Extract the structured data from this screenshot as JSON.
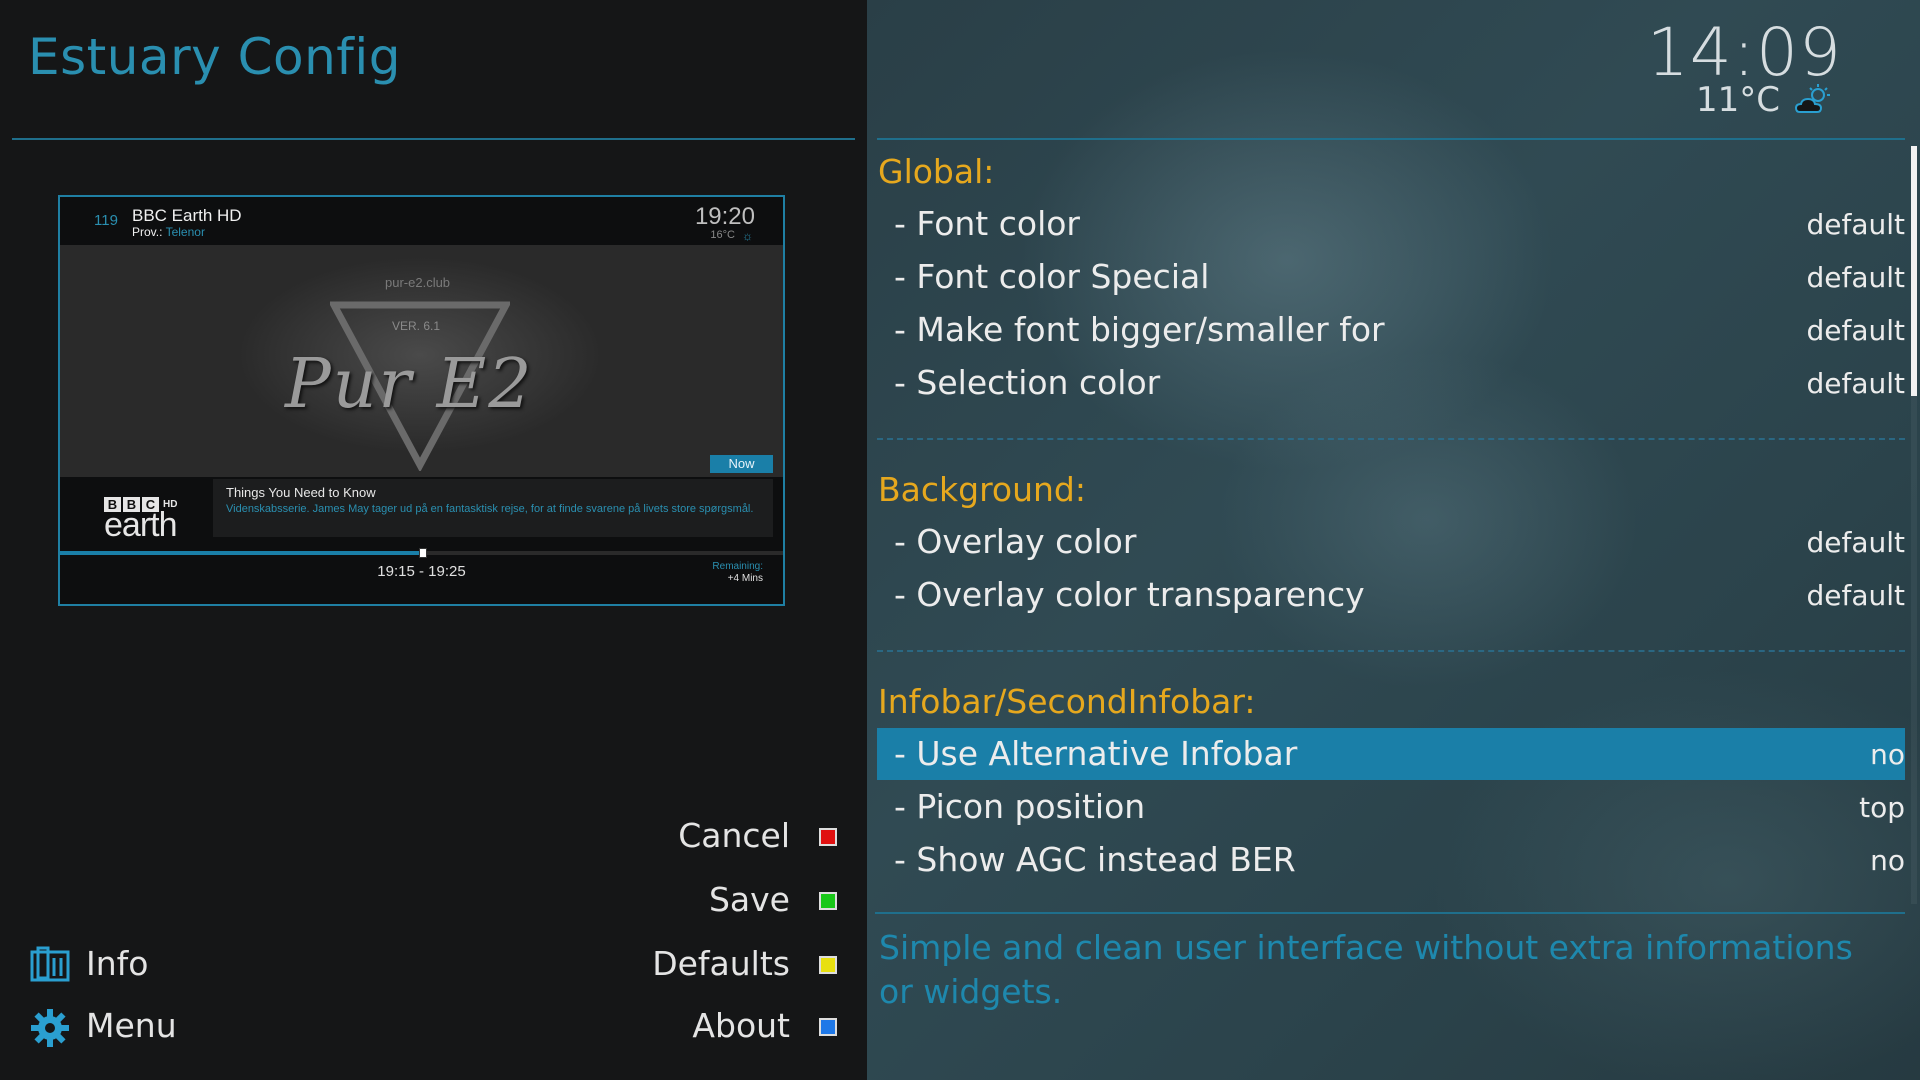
{
  "app": {
    "title": "Estuary Config"
  },
  "clock": {
    "time": "14:09",
    "temperature": "11°C",
    "weather_icon": "partly-cloudy-icon"
  },
  "preview": {
    "channel_number": "119",
    "channel_name": "BBC Earth HD",
    "provider_label": "Prov.:",
    "provider": "Telenor",
    "time": "19:20",
    "temperature": "16°C",
    "site": "pur-e2.club",
    "version": "VER. 6.1",
    "logo_text": "Pur E2",
    "now_badge": "Now",
    "bbc_letters": [
      "B",
      "B",
      "C"
    ],
    "bbc_hd": "HD",
    "bbc_earth": "earth",
    "program_title": "Things You Need to Know",
    "program_desc": "Videnskabsserie. James May tager ud på en fantasktisk rejse, for at finde svarene på livets store spørgsmål.",
    "progress": 0.5,
    "time_range": "19:15 - 19:25",
    "remaining_label": "Remaining:",
    "remaining_value": "+4 Mins"
  },
  "buttons": {
    "cancel": {
      "label": "Cancel",
      "color": "#e01010"
    },
    "save": {
      "label": "Save",
      "color": "#18c818"
    },
    "defaults": {
      "label": "Defaults",
      "color": "#e8e010"
    },
    "about": {
      "label": "About",
      "color": "#1e78e8"
    }
  },
  "nav": {
    "info": {
      "label": "Info",
      "icon": "info-icon"
    },
    "menu": {
      "label": "Menu",
      "icon": "gear-icon"
    }
  },
  "settings": {
    "global": {
      "header": "Global:",
      "items": [
        {
          "label": "- Font color",
          "value": "default"
        },
        {
          "label": "- Font color Special",
          "value": "default"
        },
        {
          "label": "- Make font bigger/smaller for",
          "value": "default"
        },
        {
          "label": "- Selection color",
          "value": "default"
        }
      ]
    },
    "background": {
      "header": "Background:",
      "items": [
        {
          "label": "- Overlay color",
          "value": "default"
        },
        {
          "label": "- Overlay color transparency",
          "value": "default"
        }
      ]
    },
    "infobar": {
      "header": "Infobar/SecondInfobar:",
      "items": [
        {
          "label": "- Use Alternative Infobar",
          "value": "no",
          "selected": true
        },
        {
          "label": "- Picon position",
          "value": "top"
        },
        {
          "label": "- Show AGC instead BER",
          "value": "no"
        }
      ]
    }
  },
  "help_text": "Simple and clean user interface without extra informations or widgets.",
  "colors": {
    "accent": "#1a7fa8",
    "section": "#e6a81e",
    "title": "#2a8fb0"
  }
}
